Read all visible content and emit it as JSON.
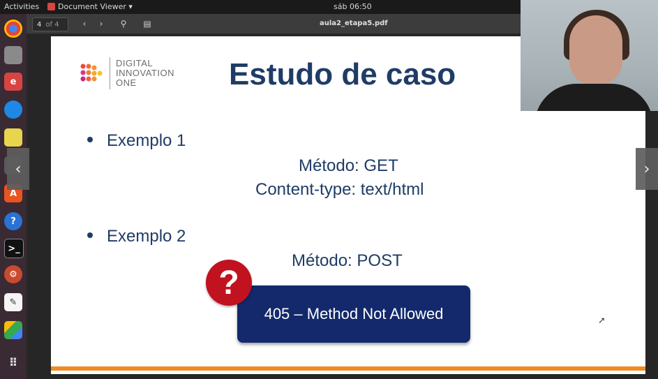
{
  "topbar": {
    "activities": "Activities",
    "app_name": "Document Viewer ▾",
    "clock": "sáb 06:50"
  },
  "toolbar": {
    "page_current": "4",
    "page_of": "of 4",
    "prev_icon": "‹",
    "next_icon": "›",
    "search_icon": "⚲",
    "sidebar_icon": "▤",
    "filename": "aula2_etapa5.pdf"
  },
  "slide": {
    "logo_lines": [
      "DIGITAL",
      "INNOVATION",
      "ONE"
    ],
    "title": "Estudo de caso",
    "bullet1": "Exemplo 1",
    "ex1_line1": "Método: GET",
    "ex1_line2": "Content-type: text/html",
    "bullet2": "Exemplo 2",
    "ex2_line1": "Método: POST",
    "question_mark": "?",
    "error_label": "405 – Method Not Allowed"
  },
  "nav": {
    "prev": "‹",
    "next": "›"
  },
  "colors": {
    "title": "#1f3c66",
    "error_box": "#13296b",
    "question": "#c1121f",
    "orange_bar": "#f08a24"
  }
}
